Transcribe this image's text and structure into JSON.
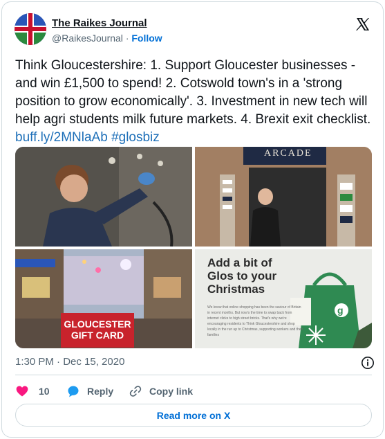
{
  "account": {
    "display_name": "The Raikes Journal",
    "handle": "@RaikesJournal",
    "separator": "·",
    "follow_label": "Follow"
  },
  "tweet": {
    "text_main": "Think Gloucestershire: 1. Support Gloucester businesses - and win £1,500 to spend! 2. Cotswold town's in a 'strong position to grow economically'. 3. Investment in new tech will help agri students milk future markets. 4. Brexit exit checklist.",
    "link": "buff.ly/2MNlaAb",
    "hashtag": "#glosbiz"
  },
  "media": {
    "photo_2_sign": "ARCADE",
    "photo_3_card": "GLOUCESTER GIFT CARD",
    "photo_4_title": "Add a bit of Glos to your Christmas",
    "photo_4_body": "We know that online shopping has been the saviour of Britain in recent months. But now's the time to swap back from internet clicks to high street bricks. That's why we're encouraging residents to Think Gloucestershire and shop locally in the run up to Christmas, supporting workers and their families"
  },
  "timestamp": "1:30 PM · Dec 15, 2020",
  "actions": {
    "like_count": "10",
    "reply_label": "Reply",
    "copy_label": "Copy link"
  },
  "read_more_label": "Read more on X",
  "colors": {
    "link_blue": "#1d6fb8",
    "follow_blue": "#006fd6",
    "like_red": "#f91880",
    "reply_blue": "#1d9bf0",
    "muted_gray": "#536471",
    "border": "#cfd9de"
  },
  "icons": [
    "flag-avatar",
    "x-logo-icon",
    "info-icon",
    "heart-icon",
    "reply-bubble-icon",
    "link-icon"
  ]
}
